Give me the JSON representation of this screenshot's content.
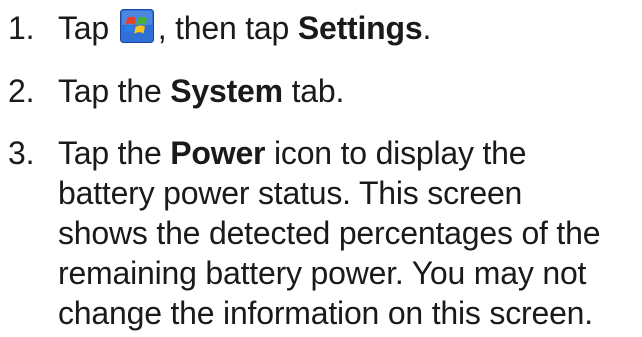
{
  "steps": [
    {
      "number": "1.",
      "before_icon": "Tap ",
      "icon": "windows-start-icon",
      "after_icon": ", then tap ",
      "bold": "Settings",
      "after_bold": "."
    },
    {
      "number": "2.",
      "before_bold": "Tap the ",
      "bold": "System",
      "after_bold": " tab."
    },
    {
      "number": "3.",
      "line1_before_bold": "Tap the ",
      "line1_bold": "Power",
      "line1_after_bold": " icon to display the",
      "line2": "battery power status. This screen",
      "line3": "shows the detected percentages of the",
      "line4": "remaining battery power. You may not",
      "line5": "change the information on this screen."
    }
  ],
  "colors": {
    "text": "#1a1a1a",
    "icon_background": "#2f6fd6",
    "flag_red": "#e8402a",
    "flag_green": "#46b336",
    "flag_blue": "#2b7de9",
    "flag_yellow": "#f6c51d"
  }
}
